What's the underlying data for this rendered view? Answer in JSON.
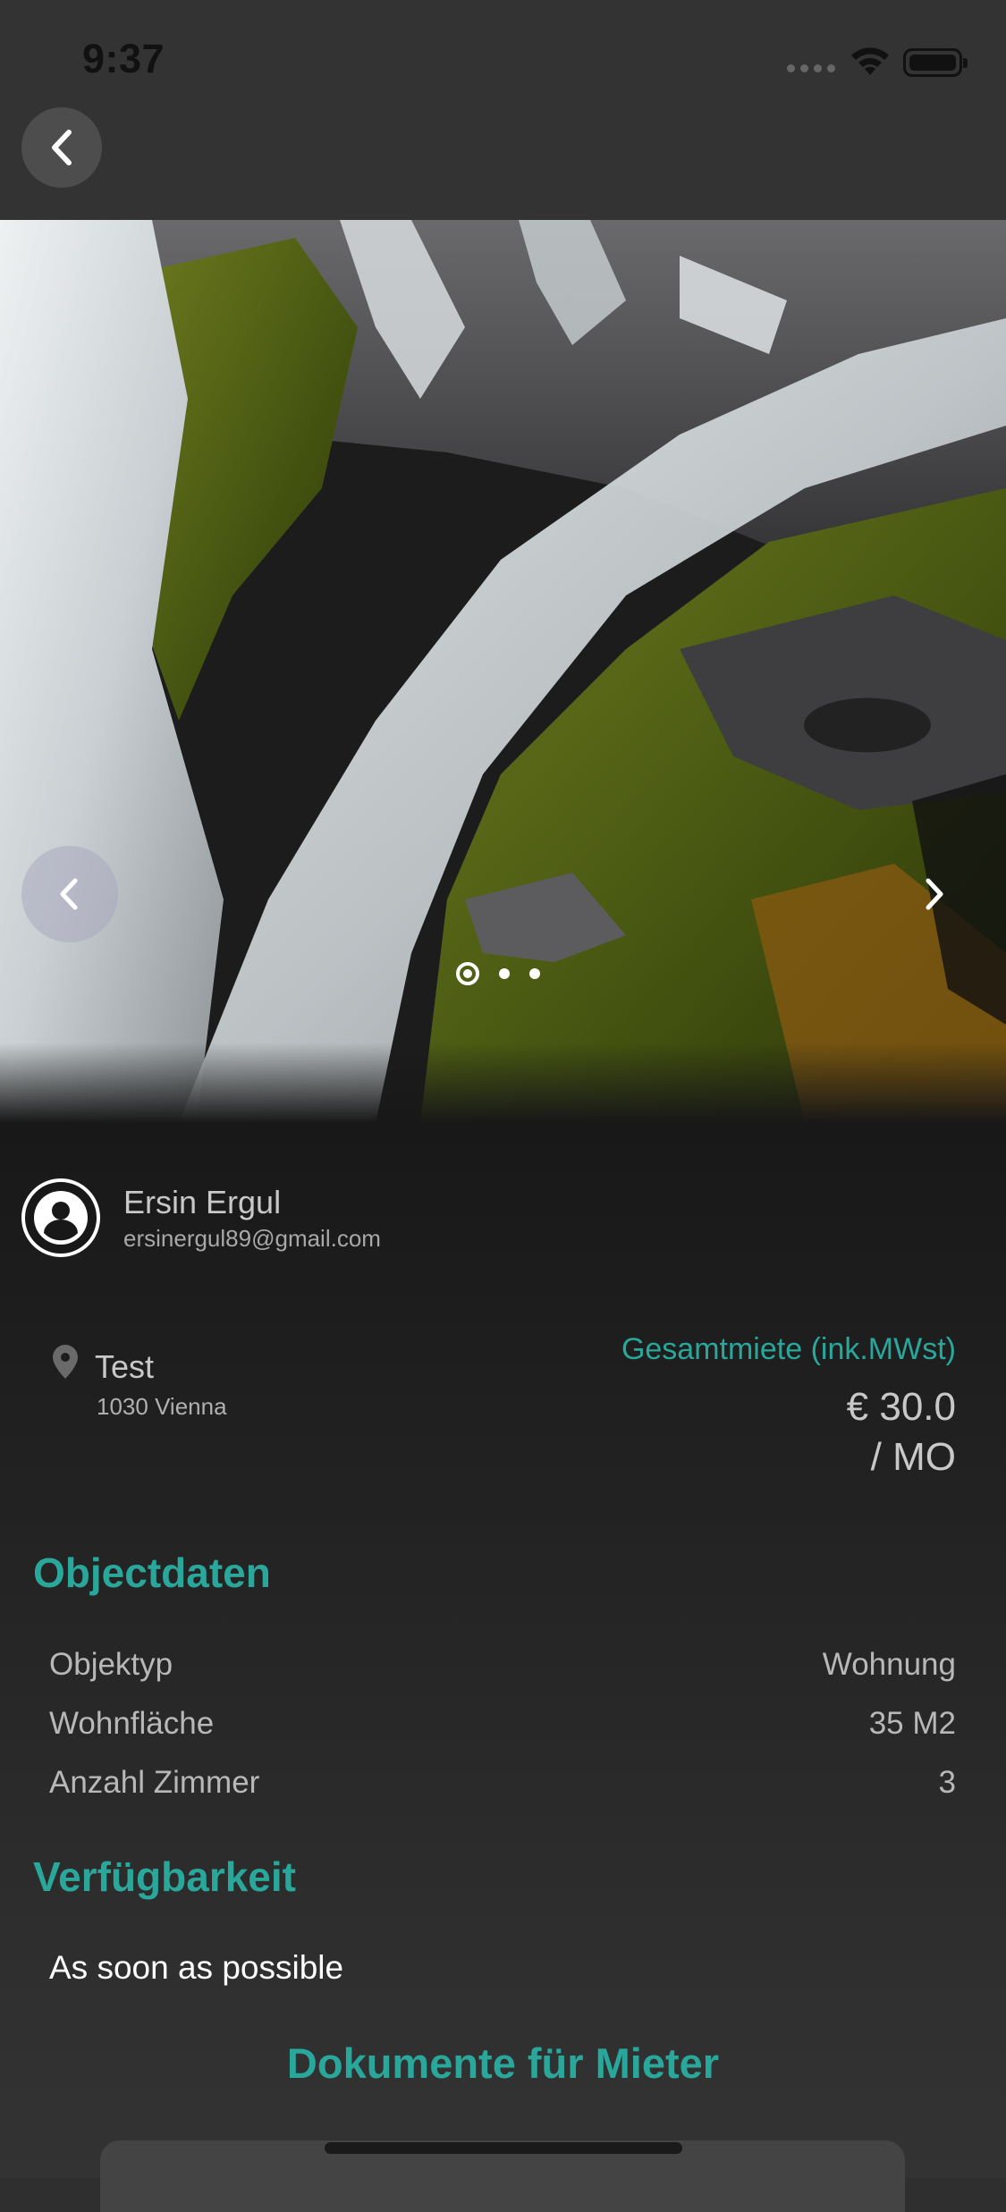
{
  "status_bar": {
    "time": "9:37"
  },
  "owner": {
    "name": "Ersin Ergul",
    "email": "ersinergul89@gmail.com"
  },
  "location": {
    "name": "Test",
    "city": "1030 Vienna"
  },
  "price": {
    "label": "Gesamtmiete (ink.MWst)",
    "amount": "€ 30.0",
    "period": "/ MO"
  },
  "carousel": {
    "slide_count": 3,
    "active_index": 0
  },
  "object_data": {
    "title": "Objectdaten",
    "rows": [
      {
        "label": "Objektyp",
        "value": "Wohnung"
      },
      {
        "label": "Wohnfläche",
        "value": "35 M2"
      },
      {
        "label": "Anzahl Zimmer",
        "value": "3"
      }
    ]
  },
  "availability": {
    "title": "Verfügbarkeit",
    "value": "As soon as possible"
  },
  "documents": {
    "title": "Dokumente für Mieter"
  },
  "colors": {
    "accent": "#2aa79b",
    "background": "#181818",
    "header": "#333333"
  }
}
